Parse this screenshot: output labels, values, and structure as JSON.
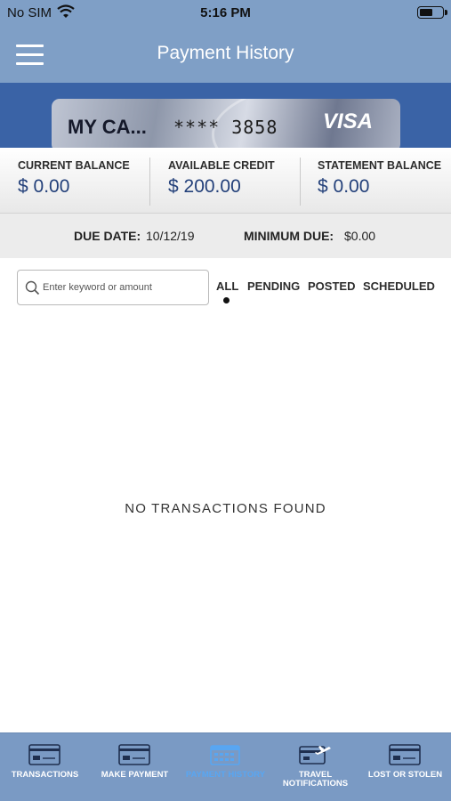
{
  "status_bar": {
    "carrier": "No SIM",
    "time": "5:16 PM",
    "battery_level": 0.6
  },
  "nav": {
    "title": "Payment History"
  },
  "card": {
    "name": "MY CA...",
    "masked_number": "**** 3858",
    "brand": "VISA"
  },
  "balances": [
    {
      "label": "CURRENT BALANCE",
      "value": "$ 0.00"
    },
    {
      "label": "AVAILABLE CREDIT",
      "value": "$ 200.00"
    },
    {
      "label": "STATEMENT BALANCE",
      "value": "$ 0.00"
    }
  ],
  "due": {
    "date_label": "DUE DATE:",
    "date_value": "10/12/19",
    "min_label": "MINIMUM DUE:",
    "min_value": "$0.00"
  },
  "search": {
    "placeholder": "Enter keyword or amount",
    "value": ""
  },
  "filters": {
    "tabs": [
      "ALL",
      "PENDING",
      "POSTED",
      "SCHEDULED"
    ],
    "active": "ALL"
  },
  "empty_message": "NO TRANSACTIONS FOUND",
  "bottom_nav": {
    "active": "PAYMENT HISTORY",
    "active_color": "#58a6f2",
    "items": [
      {
        "label": "TRANSACTIONS",
        "icon": "card-icon"
      },
      {
        "label": "MAKE PAYMENT",
        "icon": "card-icon"
      },
      {
        "label": "PAYMENT HISTORY",
        "icon": "calendar-icon"
      },
      {
        "label": "TRAVEL NOTIFICATIONS",
        "icon": "card-plane-icon"
      },
      {
        "label": "LOST OR STOLEN",
        "icon": "card-alert-icon"
      }
    ]
  }
}
